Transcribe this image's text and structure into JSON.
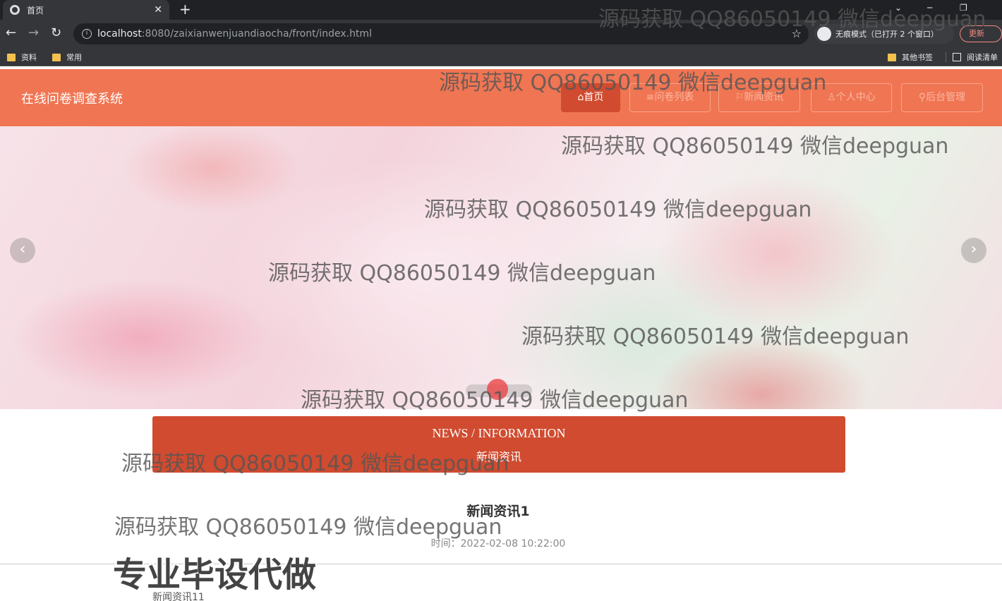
{
  "browser": {
    "tab_title": "首页",
    "tab_close": "✕",
    "new_tab": "+",
    "url_host": "localhost",
    "url_path": ":8080/zaixianwenjuandiaocha/front/index.html",
    "incognito_label": "无痕模式（已打开 2 个窗口）",
    "update_label": "更新",
    "bookmarks": [
      "资料",
      "常用"
    ],
    "bookmarks_right": [
      "其他书签",
      "阅读清单"
    ]
  },
  "site": {
    "brand": "在线问卷调查系统",
    "nav": [
      {
        "label": "⌂首页",
        "icon": "home-icon",
        "active": true
      },
      {
        "label": "≡问卷列表",
        "icon": "list-icon",
        "active": false
      },
      {
        "label": "⚐新闻资讯",
        "icon": "flag-icon",
        "active": false
      },
      {
        "label": "♙个人中心",
        "icon": "user-icon",
        "active": false
      },
      {
        "label": "⚲后台管理",
        "icon": "link-icon",
        "active": false
      }
    ]
  },
  "carousel": {
    "prev": "‹",
    "next": "›"
  },
  "news": {
    "header_en": "NEWS / INFORMATION",
    "header_cn": "新闻资讯",
    "article_title": "新闻资讯1",
    "article_time": "时间：2022-02-08 10:22:00",
    "next_item": "新闻资讯11"
  },
  "watermark": {
    "text": "源码获取 QQ86050149 微信deepguan",
    "big_text": "专业毕设代做"
  },
  "colors": {
    "nav_bg": "#f07552",
    "accent": "#d04b2f"
  }
}
